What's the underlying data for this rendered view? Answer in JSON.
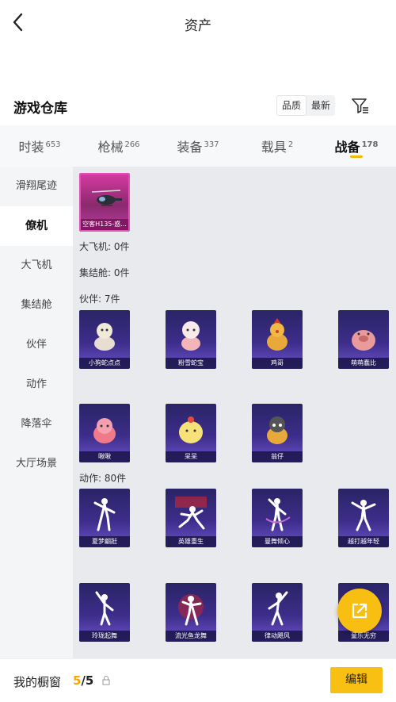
{
  "header": {
    "title": "资产"
  },
  "warehouse": {
    "title": "游戏仓库",
    "sort_options": [
      "品质",
      "最新"
    ]
  },
  "tabs": [
    {
      "label": "时装",
      "count": "653"
    },
    {
      "label": "枪械",
      "count": "266"
    },
    {
      "label": "装备",
      "count": "337"
    },
    {
      "label": "载具",
      "count": "2"
    },
    {
      "label": "战备",
      "count": "178"
    }
  ],
  "sidebar": {
    "items": [
      {
        "label": "滑翔尾迹"
      },
      {
        "label": "僚机"
      },
      {
        "label": "大飞机"
      },
      {
        "label": "集结舱"
      },
      {
        "label": "伙伴"
      },
      {
        "label": "动作"
      },
      {
        "label": "降落伞"
      },
      {
        "label": "大厅场景"
      }
    ]
  },
  "content": {
    "wingman": [
      {
        "name": "空客H135-惑..."
      }
    ],
    "big_plane_label": "大飞机: 0件",
    "pod_label": "集结舱: 0件",
    "partner_label": "伙伴: 7件",
    "partners": [
      {
        "name": "小狗蛇点点"
      },
      {
        "name": "粉雪蛇宝"
      },
      {
        "name": "鸡哥"
      },
      {
        "name": "萌萌蠢比"
      },
      {
        "name": "啾啾"
      },
      {
        "name": "呆呆"
      },
      {
        "name": "翁仔"
      }
    ],
    "action_label": "动作: 80件",
    "actions": [
      {
        "name": "夏梦翩跹"
      },
      {
        "name": "英雄重生"
      },
      {
        "name": "曼舞倾心"
      },
      {
        "name": "越打越年轻"
      },
      {
        "name": "玲珑起舞"
      },
      {
        "name": "流光鱼龙舞"
      },
      {
        "name": "律动飓风"
      },
      {
        "name": "童乐无穷"
      }
    ]
  },
  "bottom": {
    "my_window": "我的橱窗",
    "count_current": "5",
    "count_total": "/5",
    "edit_label": "编辑"
  },
  "colors": {
    "accent": "#f8c012",
    "card_purple": "#3d2d8a",
    "card_pink": "#d43aa0"
  }
}
